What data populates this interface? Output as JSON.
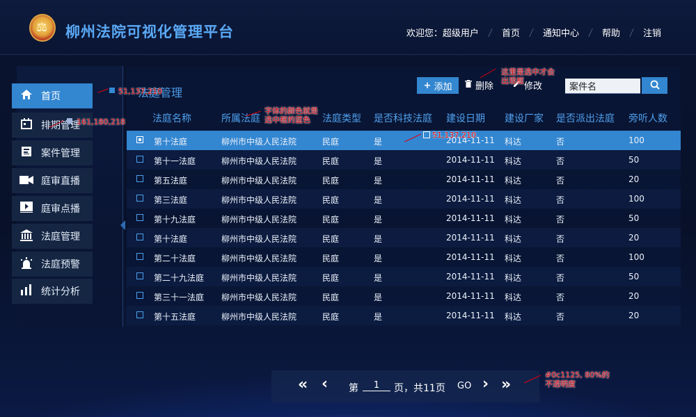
{
  "header": {
    "title": "柳州法院可视化管理平台",
    "welcome": "欢迎您：超级用户",
    "nav": [
      "首页",
      "通知中心",
      "帮助",
      "注销"
    ]
  },
  "sidebar": {
    "items": [
      {
        "label": "首页",
        "icon": "home-icon",
        "active": true
      },
      {
        "label": "排期管理",
        "icon": "calendar-icon",
        "active": false
      },
      {
        "label": "案件管理",
        "icon": "document-icon",
        "active": false
      },
      {
        "label": "庭审直播",
        "icon": "video-camera-icon",
        "active": false
      },
      {
        "label": "庭审点播",
        "icon": "play-icon",
        "active": false
      },
      {
        "label": "法庭管理",
        "icon": "court-building-icon",
        "active": false
      },
      {
        "label": "法庭预警",
        "icon": "alarm-icon",
        "active": false
      },
      {
        "label": "统计分析",
        "icon": "bar-chart-icon",
        "active": false
      }
    ]
  },
  "main": {
    "section_title": "法庭管理",
    "toolbar": {
      "add_label": "添加",
      "delete_label": "删除",
      "edit_label": "修改",
      "search_value": "案件名"
    },
    "columns": [
      "法庭名称",
      "所属法庭",
      "法庭类型",
      "是否科技法庭",
      "建设日期",
      "建设厂家",
      "是否派出法庭",
      "旁听人数"
    ],
    "rows": [
      [
        "第十法庭",
        "柳州市中级人民法院",
        "民庭",
        "是",
        "2014-11-11",
        "科达",
        "否",
        "100"
      ],
      [
        "第十一法庭",
        "柳州市中级人民法院",
        "民庭",
        "是",
        "2014-11-11",
        "科达",
        "否",
        "50"
      ],
      [
        "第五法庭",
        "柳州市中级人民法院",
        "民庭",
        "是",
        "2014-11-11",
        "科达",
        "否",
        "20"
      ],
      [
        "第三法庭",
        "柳州市中级人民法院",
        "民庭",
        "是",
        "2014-11-11",
        "科达",
        "否",
        "100"
      ],
      [
        "第十九法庭",
        "柳州市中级人民法院",
        "民庭",
        "是",
        "2014-11-11",
        "科达",
        "否",
        "50"
      ],
      [
        "第十法庭",
        "柳州市中级人民法院",
        "民庭",
        "是",
        "2014-11-11",
        "科达",
        "否",
        "20"
      ],
      [
        "第二十法庭",
        "柳州市中级人民法院",
        "民庭",
        "是",
        "2014-11-11",
        "科达",
        "否",
        "100"
      ],
      [
        "第二十九法庭",
        "柳州市中级人民法院",
        "民庭",
        "是",
        "2014-11-11",
        "科达",
        "否",
        "50"
      ],
      [
        "第三十一法庭",
        "柳州市中级人民法院",
        "民庭",
        "是",
        "2014-11-11",
        "科达",
        "否",
        "20"
      ],
      [
        "第十五法庭",
        "柳州市中级人民法院",
        "民庭",
        "是",
        "2014-11-11",
        "科达",
        "否",
        "20"
      ]
    ],
    "selected_row": 0
  },
  "pager": {
    "first": "«",
    "prev": "‹",
    "page_prefix": "第",
    "page_value": "1",
    "page_suffix": "页，共11页",
    "go": "GO",
    "next": "›",
    "last": "»"
  },
  "annotations": {
    "active_color": "51,137,210",
    "hover_color": "161,180,218",
    "header_note": "字体的颜色就是\n选中框的蓝色",
    "row_color": "51,137,210",
    "toolbar_note": "这里是选中才会\n出现框",
    "pager_note": "#0c1125, 80%的\n不透明度"
  },
  "colors": {
    "accent": "#3386d0",
    "title_blue": "#5aa9f5",
    "header_text": "#4fa0ee",
    "annotation": "#d4000d"
  }
}
